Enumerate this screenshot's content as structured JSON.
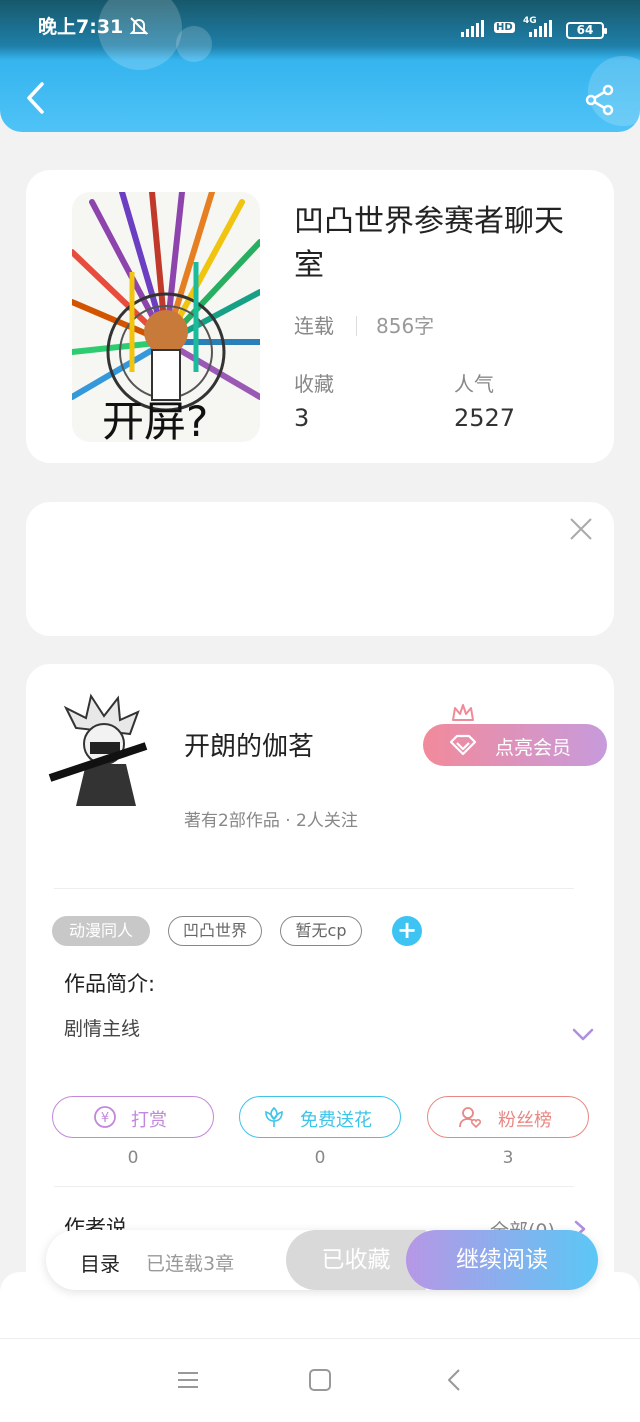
{
  "status_bar": {
    "time": "晚上7:31",
    "network": "4G",
    "hd": "HD",
    "battery": "64"
  },
  "book": {
    "title": "凹凸世界参赛者聊天室",
    "status": "连载",
    "word_count": "856字",
    "cover_text": "开屏?",
    "favorites_label": "收藏",
    "favorites": "3",
    "popularity_label": "人气",
    "popularity": "2527"
  },
  "author": {
    "name": "开朗的伽茗",
    "meta": "著有2部作品 · 2人关注",
    "vip_button": "点亮会员"
  },
  "tags": [
    "动漫同人",
    "凹凸世界",
    "暂无cp"
  ],
  "tag_add": "+",
  "intro": {
    "label": "作品简介:",
    "text": "剧情主线"
  },
  "actions": [
    {
      "label": "打赏",
      "count": "0",
      "color": "#c387db"
    },
    {
      "label": "免费送花",
      "count": "0",
      "color": "#3ec4e9"
    },
    {
      "label": "粉丝榜",
      "count": "3",
      "color": "#e98784"
    }
  ],
  "author_say": {
    "label": "作者说",
    "all": "全部(0)"
  },
  "bottom_bar": {
    "toc": "目录",
    "serial": "已连载3章",
    "collected": "已收藏",
    "continue": "继续阅读"
  },
  "icons": [
    "bell-off-icon",
    "back-icon",
    "share-icon",
    "close-icon",
    "crown-icon",
    "gem-icon",
    "expand-icon",
    "yen-icon",
    "flower-icon",
    "fan-icon",
    "menu-icon",
    "home-icon",
    "nav-back-icon"
  ]
}
